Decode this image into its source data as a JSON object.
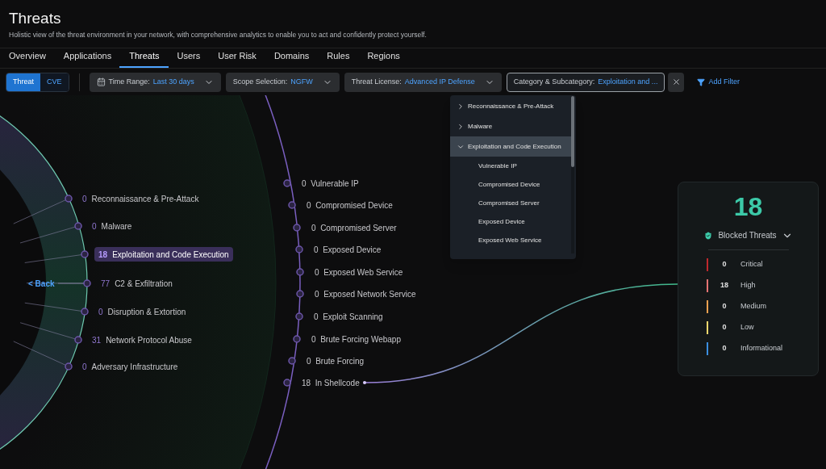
{
  "header": {
    "title": "Threats",
    "subtitle": "Holistic view of the threat environment in your network, with comprehensive analytics to enable you to act and confidently protect yourself."
  },
  "tabs": [
    {
      "label": "Overview",
      "selected": false
    },
    {
      "label": "Applications",
      "selected": false
    },
    {
      "label": "Threats",
      "selected": true
    },
    {
      "label": "Users",
      "selected": false
    },
    {
      "label": "User Risk",
      "selected": false
    },
    {
      "label": "Domains",
      "selected": false
    },
    {
      "label": "Rules",
      "selected": false
    },
    {
      "label": "Regions",
      "selected": false
    }
  ],
  "mode_toggle": [
    {
      "label": "Threat",
      "selected": true
    },
    {
      "label": "CVE",
      "selected": false
    }
  ],
  "filters": [
    {
      "kind": "date",
      "label": "Time Range:",
      "value": "Last 30 days",
      "open": false
    },
    {
      "kind": "select",
      "label": "Scope Selection:",
      "value": "NGFW",
      "open": false
    },
    {
      "kind": "select",
      "label": "Threat License:",
      "value": "Advanced IP Defense",
      "open": false
    },
    {
      "kind": "select",
      "label": "Category & Subcategory:",
      "value": "Exploitation and ...",
      "open": true
    }
  ],
  "add_filter": "Add Filter",
  "dropdown": [
    {
      "label": "Reconnaissance & Pre-Attack",
      "expanded": false
    },
    {
      "label": "Malware",
      "expanded": false
    },
    {
      "label": "Exploitation and Code Execution",
      "expanded": true,
      "children": [
        {
          "label": "Vulnerable IP"
        },
        {
          "label": "Compromised Device"
        },
        {
          "label": "Compromised Server"
        },
        {
          "label": "Exposed Device"
        },
        {
          "label": "Exposed Web Service"
        }
      ]
    }
  ],
  "back": "< Back",
  "categories": [
    {
      "count": "0",
      "label": "Reconnaissance & Pre-Attack",
      "selected": false
    },
    {
      "count": "0",
      "label": "Malware",
      "selected": false
    },
    {
      "count": "18",
      "label": "Exploitation and Code Execution",
      "selected": true
    },
    {
      "count": "77",
      "label": "C2 & Exfiltration",
      "selected": false
    },
    {
      "count": "0",
      "label": "Disruption & Extortion",
      "selected": false
    },
    {
      "count": "31",
      "label": "Network Protocol Abuse",
      "selected": false
    },
    {
      "count": "0",
      "label": "Adversary Infrastructure",
      "selected": false
    }
  ],
  "subcategories": [
    {
      "count": "0",
      "label": "Vulnerable IP"
    },
    {
      "count": "0",
      "label": "Compromised Device"
    },
    {
      "count": "0",
      "label": "Compromised Server"
    },
    {
      "count": "0",
      "label": "Exposed Device"
    },
    {
      "count": "0",
      "label": "Exposed Web Service"
    },
    {
      "count": "0",
      "label": "Exposed Network Service"
    },
    {
      "count": "0",
      "label": "Exploit Scanning"
    },
    {
      "count": "0",
      "label": "Brute Forcing Webapp"
    },
    {
      "count": "0",
      "label": "Brute Forcing"
    },
    {
      "count": "18",
      "label": "In Shellcode"
    }
  ],
  "summary": {
    "total": "18",
    "label": "Blocked Threats",
    "severities": [
      {
        "count": "0",
        "label": "Critical",
        "color": "#c0282d"
      },
      {
        "count": "18",
        "label": "High",
        "color": "#e57373"
      },
      {
        "count": "0",
        "label": "Medium",
        "color": "#f0a050"
      },
      {
        "count": "0",
        "label": "Low",
        "color": "#f5d76e"
      },
      {
        "count": "0",
        "label": "Informational",
        "color": "#3b8ee0"
      }
    ]
  }
}
